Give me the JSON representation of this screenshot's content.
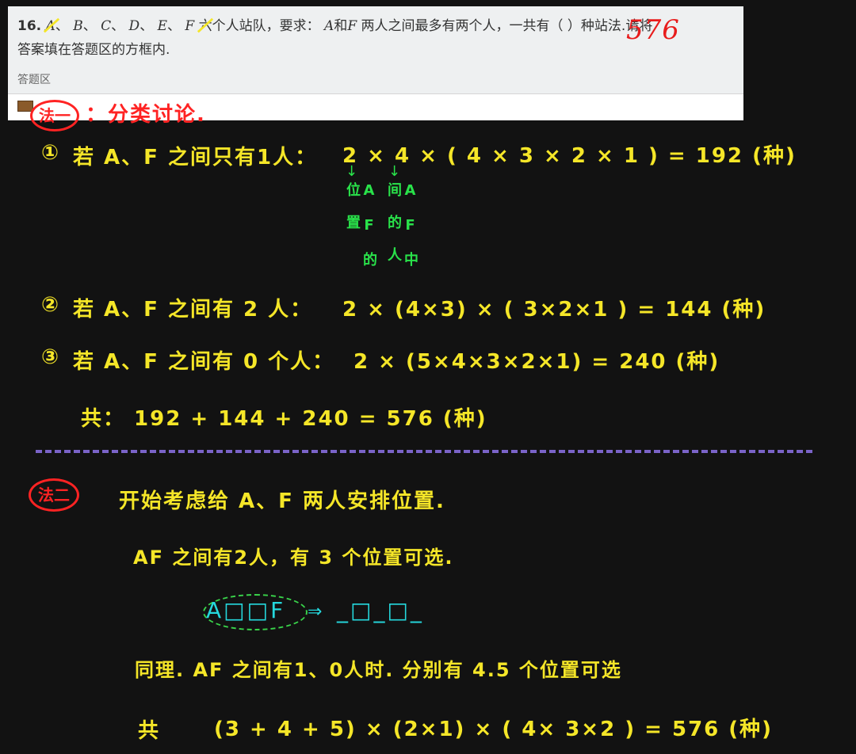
{
  "question": {
    "number": "16.",
    "line1_letters": [
      "A",
      "B",
      "C",
      "D",
      "E",
      "F"
    ],
    "line1_text": "六个人站队，要求：",
    "line1_text2": "和",
    "line1_text3": "两人之间最多有两个人，一共有（ ）种站法.请将",
    "line2": "答案填在答题区的方框内.",
    "answer_area_label": "答题区",
    "handwritten_answer": "576"
  },
  "method1": {
    "label": "法一",
    "title": "：分类讨论."
  },
  "case1": {
    "marker": "①",
    "text": "若 A、F 之间只有1人：",
    "formula": "2 × 4 × ( 4 × 3 × 2 × 1 ) = 192 (种)",
    "note_a": "A F 的 位 置",
    "note_b": "A F 中 间 的 人"
  },
  "case2": {
    "marker": "②",
    "text": "若 A、F 之间有 2 人：",
    "formula": "2 × (4×3) × ( 3×2×1 ) = 144 (种)"
  },
  "case3": {
    "marker": "③",
    "text": "若 A、F 之间有 0 个人：",
    "formula": "2 × (5×4×3×2×1) = 240 (种)"
  },
  "total1": {
    "text": "共：  192 + 144 + 240 = 576 (种)"
  },
  "method2": {
    "label": "法二",
    "line1": "开始考虑给 A、F 两人安排位置.",
    "line2": "AF 之间有2人，有 3 个位置可选.",
    "diagram_left": "A□□F",
    "arrow": "⇒",
    "diagram_right": "_□_□_",
    "line3": "同理. AF 之间有1、0人时. 分别有 4.5 个位置可选",
    "total_label": "共",
    "total_formula": "(3 + 4 + 5) × (2×1) × ( 4× 3×2 ) = 576 (种)"
  },
  "colors": {
    "background": "#121212",
    "yellow": "#f5e628",
    "red": "#ff2323",
    "cyan": "#25d8dd",
    "green": "#29e24a",
    "purple_divider": "#7a63c8"
  }
}
